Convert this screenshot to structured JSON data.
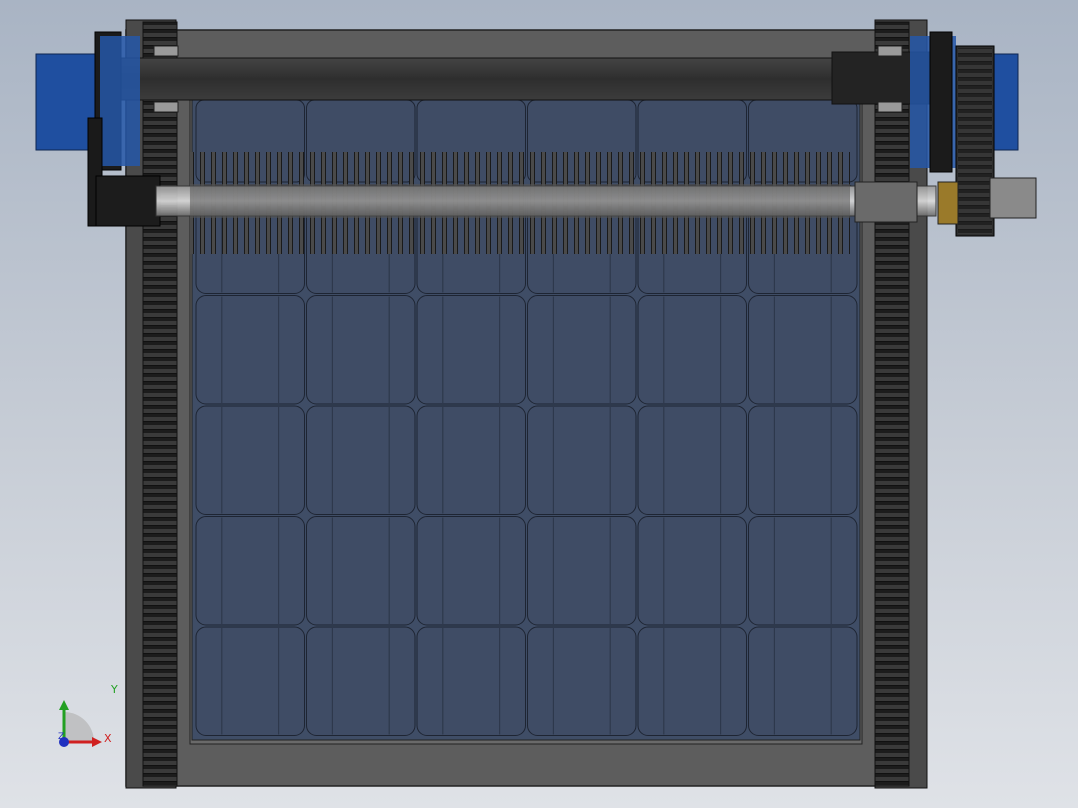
{
  "viewport": {
    "background_top": "#a9b4c4",
    "background_bottom": "#dfe2e7"
  },
  "model": {
    "frame_color": "#5d5d5d",
    "panel_color": "#3f4d66",
    "cell_color": "#3f4c65",
    "track_color": "#2a2a2a",
    "motor_color": "#1f4fa0",
    "beam_color": "#333333",
    "cell_rows": 5,
    "cell_cols": 6
  },
  "triad": {
    "x_label": "X",
    "y_label": "Y",
    "z_label": "Z",
    "x_color": "#d02020",
    "y_color": "#22a022",
    "z_color": "#2030c0"
  }
}
